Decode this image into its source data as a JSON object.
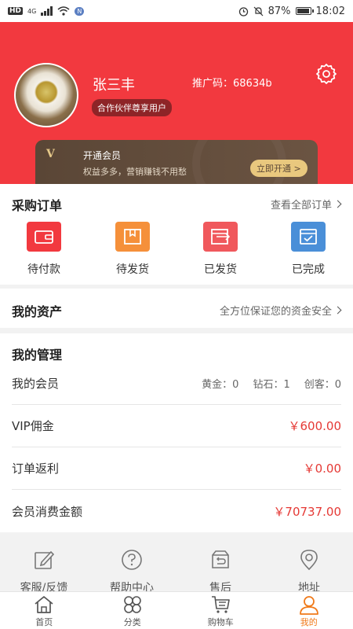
{
  "status_bar": {
    "left_badges": [
      "HD",
      "4G"
    ],
    "battery": "87%",
    "time": "18:02",
    "icons": [
      "signal-icon",
      "wifi-icon",
      "nfc-icon",
      "alarm-icon",
      "mute-icon",
      "battery-icon"
    ]
  },
  "profile": {
    "username": "张三丰",
    "referral": "推广码：68634b",
    "partner_tag": "合作伙伴尊享用户"
  },
  "vip_banner": {
    "badge": "V",
    "title": "开通会员",
    "subtitle": "权益多多，营销赚钱不用愁",
    "button": "立即开通 >"
  },
  "orders": {
    "title": "采购订单",
    "view_all": "查看全部订单",
    "items": [
      {
        "label": "待付款",
        "color": "#f2393f"
      },
      {
        "label": "待发货",
        "color": "#f5903a"
      },
      {
        "label": "已发货",
        "color": "#f0585c"
      },
      {
        "label": "已完成",
        "color": "#4a8fd8"
      }
    ]
  },
  "assets": {
    "title": "我的资产",
    "link": "全方位保证您的资金安全"
  },
  "management": {
    "title": "我的管理",
    "member_label": "我的会员",
    "member_stats": [
      "黄金：0",
      "钻石：1",
      "创客：0"
    ],
    "vip_commission_label": "VIP佣金",
    "vip_commission_value": "￥600.00",
    "order_rebate_label": "订单返利",
    "order_rebate_value": "￥0.00",
    "member_spend_label": "会员消费金额",
    "member_spend_value": "￥70737.00"
  },
  "tools": [
    {
      "label": "客服/反馈",
      "icon": "edit-icon"
    },
    {
      "label": "帮助中心",
      "icon": "help-icon"
    },
    {
      "label": "售后",
      "icon": "return-icon"
    },
    {
      "label": "地址",
      "icon": "location-icon"
    }
  ],
  "tabbar": {
    "items": [
      {
        "label": "首页",
        "icon": "home-icon"
      },
      {
        "label": "分类",
        "icon": "category-icon"
      },
      {
        "label": "购物车",
        "icon": "cart-icon"
      },
      {
        "label": "我的",
        "icon": "user-icon"
      }
    ],
    "active_index": 3,
    "active_color": "#f07a1a"
  },
  "colors": {
    "brand_red": "#f2393f",
    "price_red": "#e53935",
    "vip_gold": "#e9c87e"
  }
}
